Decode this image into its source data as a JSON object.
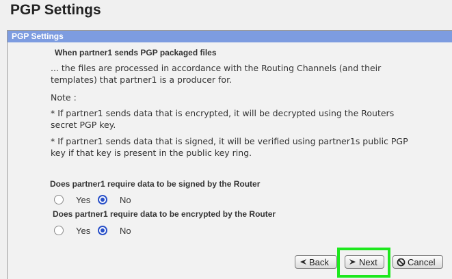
{
  "page_title": "PGP Settings",
  "panel": {
    "header": "PGP Settings",
    "heading": "When partner1 sends PGP packaged files",
    "intro_line1": "... the files are processed in accordance with the Routing Channels (and their",
    "intro_line2": "templates) that partner1 is a producer for.",
    "note_label": "Note :",
    "note1_line1": "*  If partner1 sends data that is encrypted, it will be decrypted using the Routers",
    "note1_line2": "secret PGP key.",
    "note2_line1": "*  If partner1 sends data that is signed, it will be verified using partner1s public PGP",
    "note2_line2": "key if that key is present in the public key ring."
  },
  "questions": {
    "signed": {
      "label": "Does partner1 require data to be signed by the Router",
      "yes": "Yes",
      "no": "No",
      "selected": "No"
    },
    "encrypted": {
      "label": "Does partner1 require data to be encrypted by the Router",
      "yes": "Yes",
      "no": "No",
      "selected": "No"
    }
  },
  "buttons": {
    "back": "Back",
    "next": "Next",
    "cancel": "Cancel"
  },
  "colors": {
    "header_bg": "#7d9ce0",
    "radio_selected": "#2950c8",
    "highlight": "#1ee81e"
  }
}
